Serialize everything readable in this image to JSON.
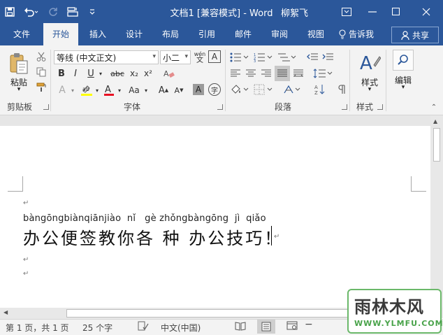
{
  "window": {
    "title": "文档1 [兼容模式]  -  Word",
    "user": "柳絮飞"
  },
  "tabs": [
    {
      "label": "文件"
    },
    {
      "label": "开始"
    },
    {
      "label": "插入"
    },
    {
      "label": "设计"
    },
    {
      "label": "布局"
    },
    {
      "label": "引用"
    },
    {
      "label": "邮件"
    },
    {
      "label": "审阅"
    },
    {
      "label": "视图"
    }
  ],
  "tellme": "告诉我",
  "share": "共享",
  "ribbon": {
    "clipboard": {
      "label": "剪贴板",
      "paste": "粘贴"
    },
    "font": {
      "label": "字体",
      "font_name": "等线 (中文正文)",
      "font_size": "小二",
      "wen_glyph": "wén",
      "wen_char": "文",
      "bold": "B",
      "italic": "I",
      "underline": "U",
      "strike": "abc",
      "sub": "x₂",
      "sup": "x²",
      "change_case": "Aa",
      "grow": "A",
      "shrink": "A",
      "char_shade": "A",
      "enclose": "字"
    },
    "paragraph": {
      "label": "段落"
    },
    "styles": {
      "label": "样式",
      "button": "样式"
    },
    "editing": {
      "button": "编辑"
    }
  },
  "document": {
    "pinyin": "bàngōngbiànqiānjiào  nǐ   gè zhǒngbàngōng  jì  qiǎo",
    "text": "办公便签教你各 种 办公技巧！",
    "para_mark": "↵"
  },
  "status": {
    "pages": "第 1 页，共 1 页",
    "words": "25 个字",
    "language": "中文(中国)"
  },
  "watermark": {
    "text": "雨林木风",
    "url": "WWW.YLMFU.COM"
  },
  "colors": {
    "brand": "#2b579a",
    "highlight": "#ffff00",
    "font_color": "#e81123"
  }
}
